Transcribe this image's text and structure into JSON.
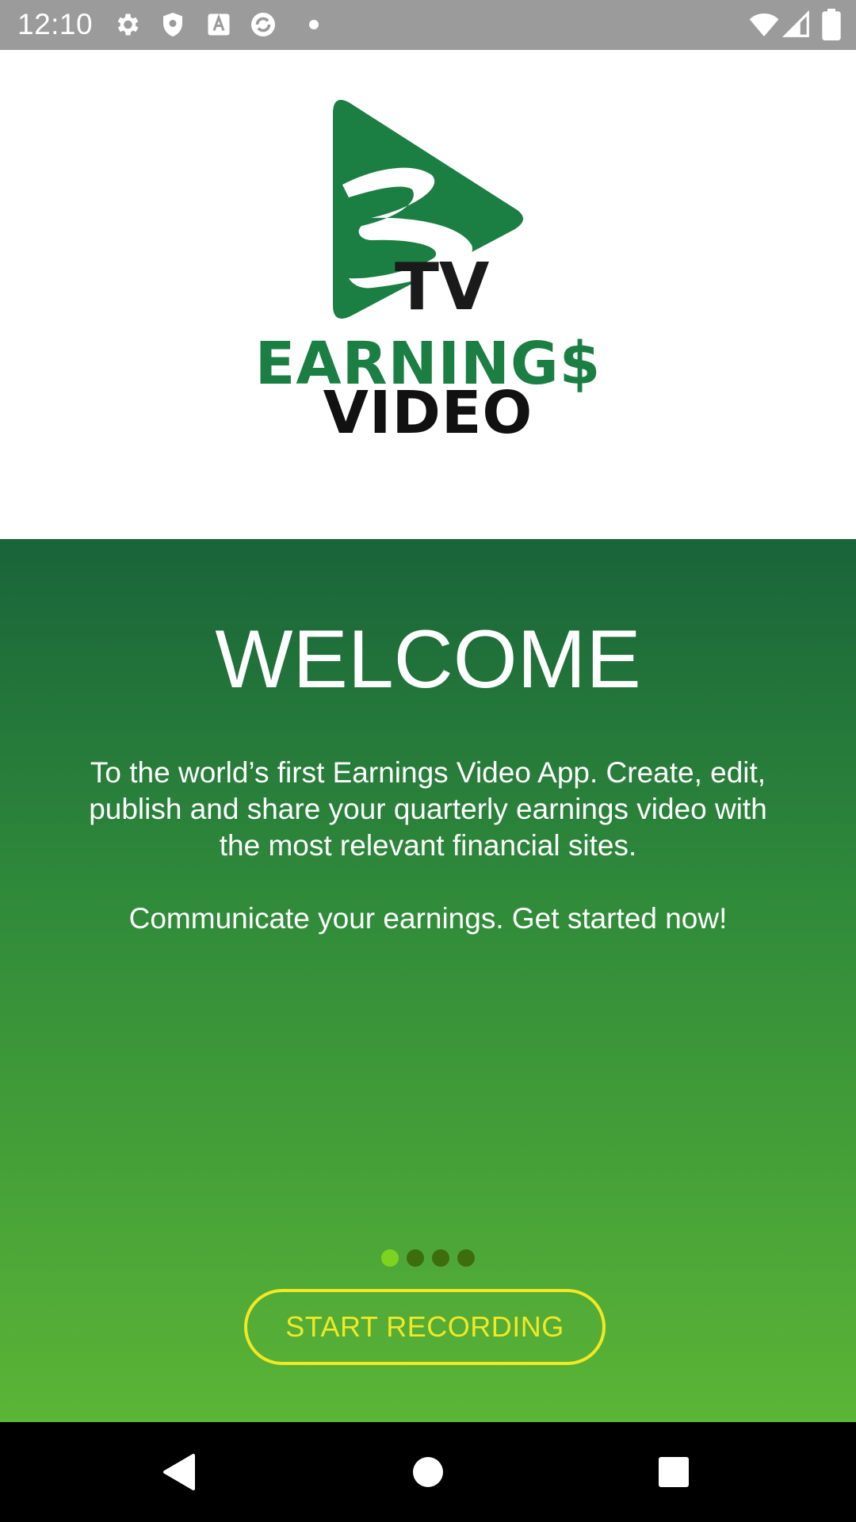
{
  "status_bar": {
    "time": "12:10",
    "icons": [
      "settings-icon",
      "shield-icon",
      "text-icon",
      "sync-icon",
      "dot-icon",
      "wifi-icon",
      "signal-icon",
      "battery-icon"
    ]
  },
  "logo": {
    "tv": "TV",
    "line1": "EARNING$",
    "line2": "VIDEO",
    "brand_green": "#1b7f44"
  },
  "welcome": {
    "title": "WELCOME",
    "body_lines": [
      "To the world’s first Earnings Video App. Create, edit,",
      "publish and share your quarterly earnings video with",
      "the most relevant financial sites."
    ],
    "tagline": "Communicate your earnings. Get started now!",
    "pager": {
      "total": 4,
      "active": 1
    },
    "button_label": "START RECORDING",
    "button_color": "#f2e824"
  },
  "nav_bar": {
    "buttons": [
      "back-icon",
      "home-icon",
      "recents-icon"
    ]
  }
}
